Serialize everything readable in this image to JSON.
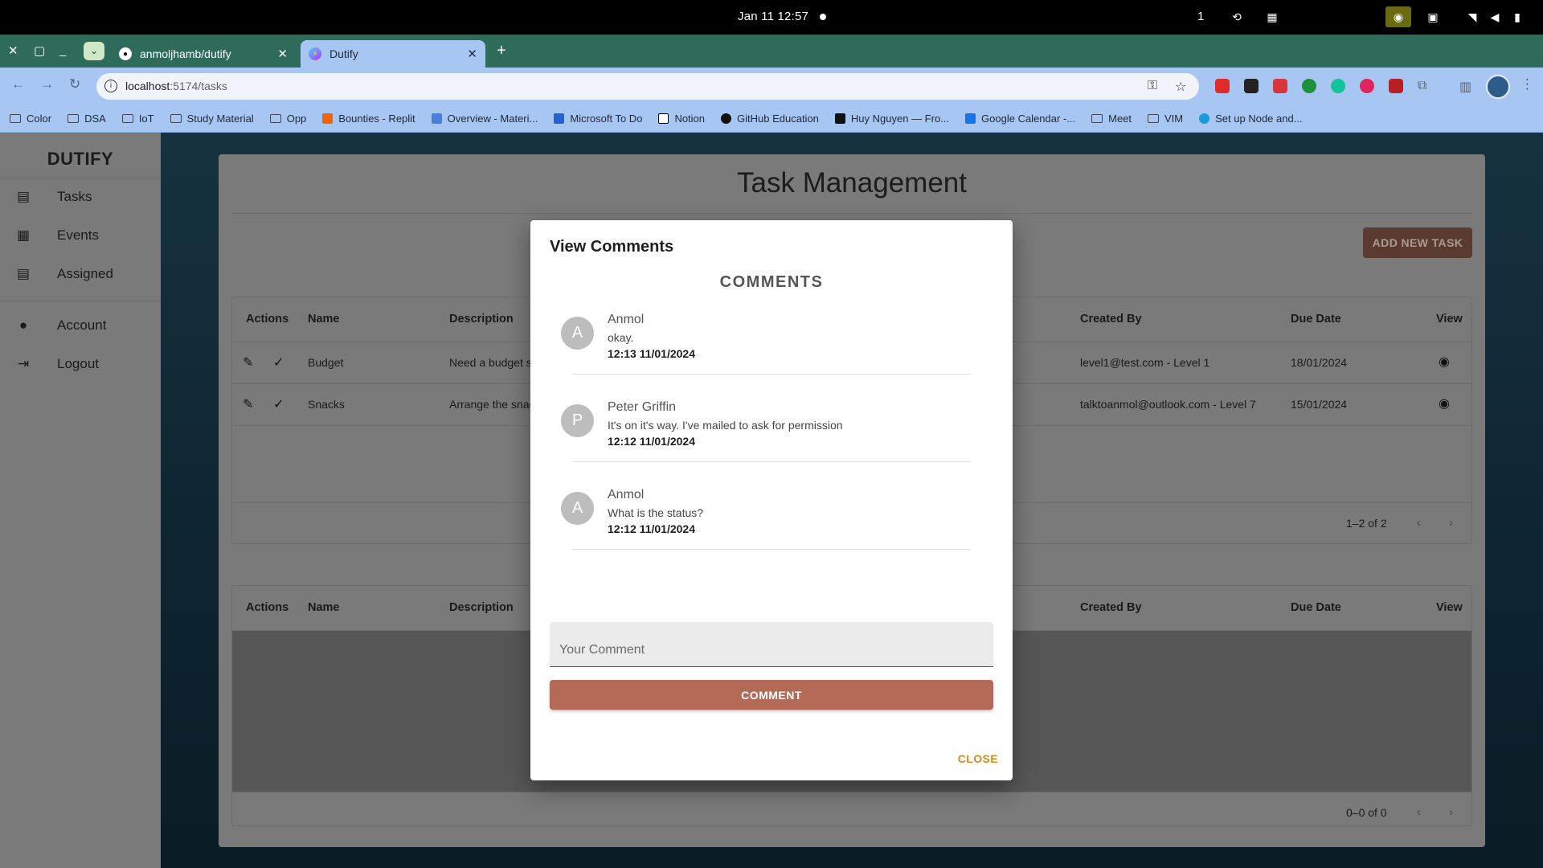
{
  "os": {
    "clock": "Jan 11  12:57",
    "workspace": "1",
    "tray": [
      "picture-in-picture-icon",
      "grid-icon",
      "wifi-icon",
      "volume-icon",
      "battery-icon"
    ]
  },
  "browser": {
    "tabs": [
      {
        "title": "anmoljhamb/dutify",
        "icon": "github-icon"
      },
      {
        "title": "Dutify",
        "icon": "vite-icon"
      }
    ],
    "url_host": "localhost",
    "url_path": ":5174/tasks",
    "bookmarks": [
      {
        "label": "Color",
        "type": "folder"
      },
      {
        "label": "DSA",
        "type": "folder"
      },
      {
        "label": "IoT",
        "type": "folder"
      },
      {
        "label": "Study Material",
        "type": "folder"
      },
      {
        "label": "Opp",
        "type": "folder"
      },
      {
        "label": "Bounties - Replit",
        "type": "link",
        "color": "#f26207"
      },
      {
        "label": "Overview - Materi...",
        "type": "link",
        "color": "#4a7fdc"
      },
      {
        "label": "Microsoft To Do",
        "type": "link",
        "color": "#2564cf"
      },
      {
        "label": "Notion",
        "type": "link",
        "color": "#000000"
      },
      {
        "label": "GitHub Education",
        "type": "link",
        "color": "#111111"
      },
      {
        "label": "Huy Nguyen — Fro...",
        "type": "link",
        "color": "#111111"
      },
      {
        "label": "Google Calendar -...",
        "type": "link",
        "color": "#1a73e8"
      },
      {
        "label": "Meet",
        "type": "folder"
      },
      {
        "label": "VIM",
        "type": "folder"
      },
      {
        "label": "Set up Node and...",
        "type": "link",
        "color": "#1a9bd7"
      }
    ]
  },
  "sidebar": {
    "brand": "DUTIFY",
    "items": [
      {
        "label": "Tasks",
        "icon": "task-icon"
      },
      {
        "label": "Events",
        "icon": "calendar-icon"
      },
      {
        "label": "Assigned",
        "icon": "assigned-icon"
      },
      {
        "label": "Account",
        "icon": "person-icon"
      },
      {
        "label": "Logout",
        "icon": "logout-icon"
      }
    ]
  },
  "main": {
    "title": "Task Management",
    "add_button": "ADD NEW TASK",
    "columns": {
      "actions": "Actions",
      "name": "Name",
      "description": "Description",
      "created_by": "Created By",
      "due_date": "Due Date",
      "view": "View"
    },
    "rows": [
      {
        "name": "Budget",
        "description": "Need a budget s",
        "created_by": "level1@test.com - Level 1",
        "due_date": "18/01/2024"
      },
      {
        "name": "Snacks",
        "description": "Arrange the snac",
        "created_by": "talktoanmol@outlook.com - Level 7",
        "due_date": "15/01/2024"
      }
    ],
    "pager_top": "1–2 of 2",
    "pager_bottom": "0–0 of 0"
  },
  "modal": {
    "title": "View Comments",
    "heading": "COMMENTS",
    "comments": [
      {
        "initial": "A",
        "author": "Anmol",
        "text": "okay.",
        "time": "12:13 11/01/2024"
      },
      {
        "initial": "P",
        "author": "Peter Griffin",
        "text": "It's on it's way. I've mailed to ask for permission",
        "time": "12:12 11/01/2024"
      },
      {
        "initial": "A",
        "author": "Anmol",
        "text": "What is the status?",
        "time": "12:12 11/01/2024"
      }
    ],
    "input_placeholder": "Your Comment",
    "comment_button": "COMMENT",
    "close_button": "CLOSE"
  }
}
